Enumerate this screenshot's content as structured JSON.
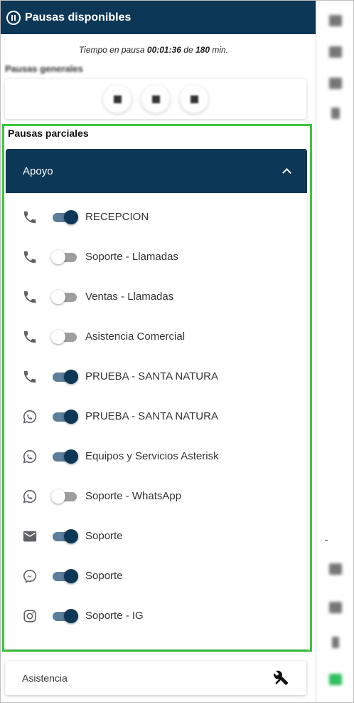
{
  "header": {
    "title": "Pausas disponibles",
    "icon": "pause-circle-icon"
  },
  "timer": {
    "prefix": "Tiempo en pausa",
    "elapsed": "00:01:36",
    "sep": "de",
    "limit": "180",
    "unit": "min."
  },
  "general": {
    "title_blurred": "Pausas generales",
    "buttons": [
      "pause-option-1",
      "pause-option-2",
      "pause-option-3"
    ]
  },
  "partial": {
    "title": "Pausas parciales",
    "group": {
      "title": "Apoyo",
      "expanded": true,
      "items": [
        {
          "icon": "phone-icon",
          "label": "RECEPCION",
          "on": true
        },
        {
          "icon": "phone-icon",
          "label": "Soporte - Llamadas",
          "on": false
        },
        {
          "icon": "phone-icon",
          "label": "Ventas - Llamadas",
          "on": false
        },
        {
          "icon": "phone-icon",
          "label": "Asistencia Comercial",
          "on": false
        },
        {
          "icon": "phone-icon",
          "label": "PRUEBA - SANTA NATURA",
          "on": true
        },
        {
          "icon": "whatsapp-icon",
          "label": "PRUEBA - SANTA NATURA",
          "on": true
        },
        {
          "icon": "whatsapp-icon",
          "label": "Equipos y Servicios Asterisk",
          "on": true
        },
        {
          "icon": "whatsapp-icon",
          "label": "Soporte - WhatsApp",
          "on": false
        },
        {
          "icon": "email-icon",
          "label": "Soporte",
          "on": true
        },
        {
          "icon": "messenger-icon",
          "label": "Soporte",
          "on": true
        },
        {
          "icon": "instagram-icon",
          "label": "Soporte - IG",
          "on": true
        }
      ]
    }
  },
  "assist": {
    "label": "Asistencia",
    "icon": "tools-icon"
  },
  "colors": {
    "primary": "#0d3757",
    "highlight": "#3ec53e",
    "switch_on_track": "#5c7e99"
  }
}
